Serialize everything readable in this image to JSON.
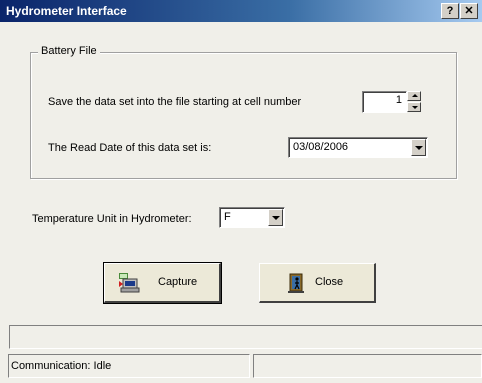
{
  "window": {
    "title": "Hydrometer Interface",
    "help_button": "?",
    "close_button": "✕"
  },
  "battery_group": {
    "legend": "Battery File",
    "save_label": "Save the data set into the file starting at cell number",
    "cell_number": "1",
    "read_date_label": "The Read Date of this data set is:",
    "read_date_value": "03/08/2006"
  },
  "temperature": {
    "label": "Temperature Unit in Hydrometer:",
    "unit": "F"
  },
  "buttons": {
    "capture": "Capture",
    "close": "Close"
  },
  "status": {
    "communication": "Communication: Idle",
    "secondary": ""
  },
  "icons": {
    "capture": "computer-capture-icon",
    "close": "exit-door-icon"
  },
  "colors": {
    "titlebar_start": "#0a246a",
    "titlebar_end": "#a6caf0",
    "background": "#f0efe9"
  }
}
